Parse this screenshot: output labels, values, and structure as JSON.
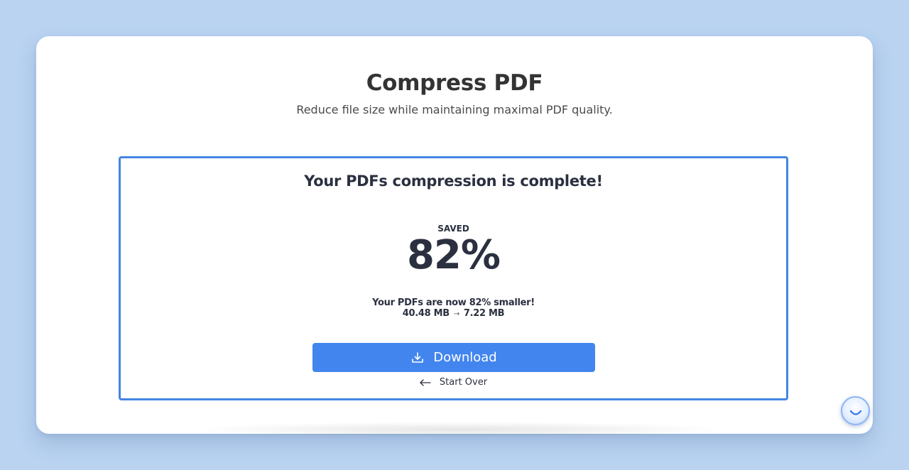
{
  "header": {
    "title": "Compress PDF",
    "subtitle": "Reduce file size while maintaining maximal PDF quality."
  },
  "result": {
    "heading": "Your PDFs compression is complete!",
    "saved_label": "SAVED",
    "saved_value": "82%",
    "smaller_text": "Your PDFs are now 82% smaller!",
    "original_size": "40.48 MB",
    "compressed_size": "7.22 MB",
    "arrow": "→"
  },
  "actions": {
    "download_label": "Download",
    "start_over_label": "Start Over"
  },
  "colors": {
    "background": "#b9d3f1",
    "accent": "#4385ef",
    "border": "#4485e5",
    "text_dark": "#2b3040"
  },
  "icons": {
    "download": "download-icon",
    "back": "arrow-left-icon",
    "chat": "chat-widget-icon"
  }
}
